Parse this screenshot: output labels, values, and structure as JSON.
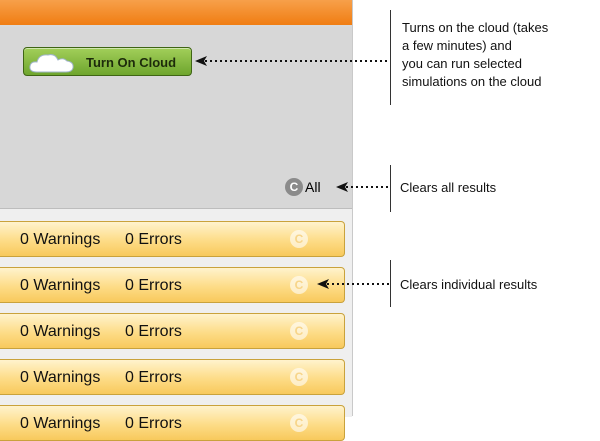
{
  "toolbar": {
    "cloud_button_label": "Turn On Cloud",
    "clear_all_icon_letter": "C",
    "clear_all_label": "All"
  },
  "results": [
    {
      "warnings": "0 Warnings",
      "errors": "0 Errors",
      "clear_icon_letter": "C"
    },
    {
      "warnings": "0 Warnings",
      "errors": "0 Errors",
      "clear_icon_letter": "C"
    },
    {
      "warnings": "0 Warnings",
      "errors": "0 Errors",
      "clear_icon_letter": "C"
    },
    {
      "warnings": "0 Warnings",
      "errors": "0 Errors",
      "clear_icon_letter": "C"
    },
    {
      "warnings": "0 Warnings",
      "errors": "0 Errors",
      "clear_icon_letter": "C"
    }
  ],
  "annotations": {
    "cloud_line1": "Turns on the cloud (takes",
    "cloud_line2": "a few minutes) and",
    "cloud_line3": "you can run selected",
    "cloud_line4": "simulations on the cloud",
    "clear_all": "Clears all results",
    "clear_individual": "Clears individual  results"
  },
  "colors": {
    "top_bar": "#f08a1f",
    "cloud_button": "#8bbf45",
    "result_row": "#fddc87"
  }
}
